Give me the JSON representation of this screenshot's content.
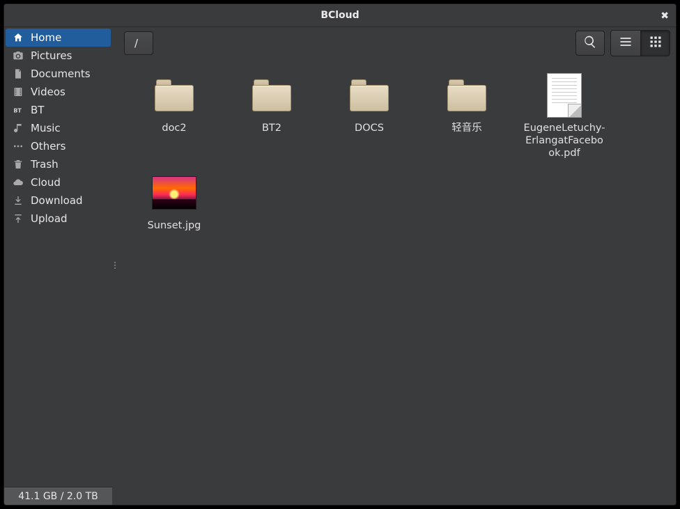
{
  "window": {
    "title": "BCloud",
    "close_glyph": "✖"
  },
  "toolbar": {
    "path": "/"
  },
  "sidebar": {
    "items": [
      {
        "id": "home",
        "label": "Home",
        "icon": "home-icon",
        "active": true
      },
      {
        "id": "pictures",
        "label": "Pictures",
        "icon": "camera-icon",
        "active": false
      },
      {
        "id": "documents",
        "label": "Documents",
        "icon": "document-icon",
        "active": false
      },
      {
        "id": "videos",
        "label": "Videos",
        "icon": "film-icon",
        "active": false
      },
      {
        "id": "bt",
        "label": "BT",
        "icon": "bt-icon",
        "active": false
      },
      {
        "id": "music",
        "label": "Music",
        "icon": "music-icon",
        "active": false
      },
      {
        "id": "others",
        "label": "Others",
        "icon": "dots-icon",
        "active": false
      },
      {
        "id": "trash",
        "label": "Trash",
        "icon": "trash-icon",
        "active": false
      },
      {
        "id": "cloud",
        "label": "Cloud",
        "icon": "cloud-icon",
        "active": false
      },
      {
        "id": "download",
        "label": "Download",
        "icon": "download-icon",
        "active": false
      },
      {
        "id": "upload",
        "label": "Upload",
        "icon": "upload-icon",
        "active": false
      }
    ]
  },
  "storage": {
    "text": "41.1 GB / 2.0 TB"
  },
  "files": [
    {
      "name": "doc2",
      "kind": "folder"
    },
    {
      "name": "BT2",
      "kind": "folder"
    },
    {
      "name": "DOCS",
      "kind": "folder"
    },
    {
      "name": "轻音乐",
      "kind": "folder"
    },
    {
      "name": "EugeneLetuchy-ErlangatFacebook.pdf",
      "kind": "pdf"
    },
    {
      "name": "Sunset.jpg",
      "kind": "image"
    }
  ]
}
